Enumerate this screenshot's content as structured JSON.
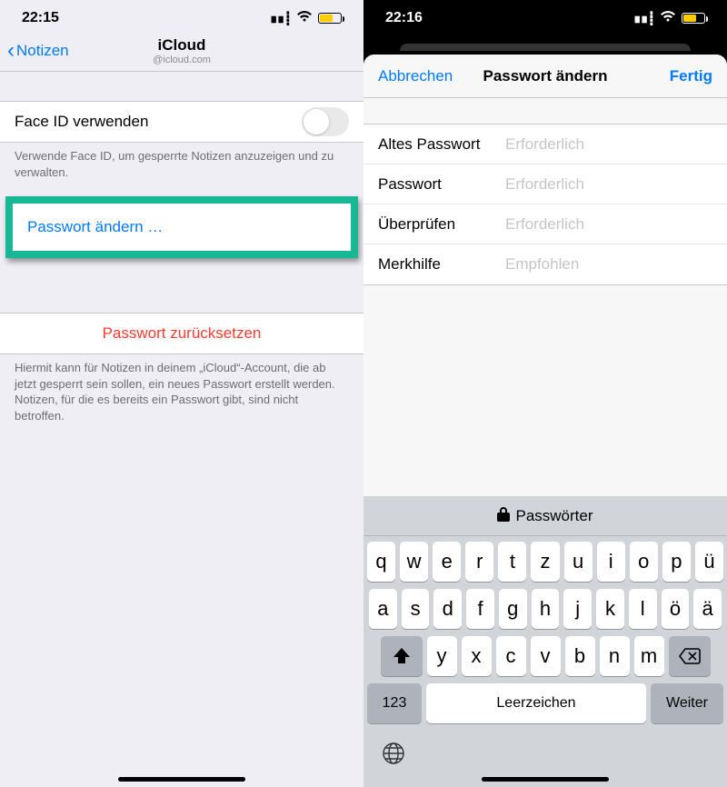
{
  "left": {
    "status_time": "22:15",
    "back_label": "Notizen",
    "title": "iCloud",
    "subtitle": "@icloud.com",
    "faceid_label": "Face ID verwenden",
    "faceid_footer": "Verwende Face ID, um gesperrte Notizen anzuzeigen und zu verwalten.",
    "change_pw_label": "Passwort ändern …",
    "reset_pw_label": "Passwort zurücksetzen",
    "reset_footer": "Hiermit kann für Notizen in deinem „iCloud“-Account, die ab jetzt gesperrt sein sollen, ein neues Passwort erstellt werden. Notizen, für die es bereits ein Passwort gibt, sind nicht betroffen."
  },
  "right": {
    "status_time": "22:16",
    "cancel": "Abbrechen",
    "title": "Passwort ändern",
    "done": "Fertig",
    "fields": [
      {
        "label": "Altes Passwort",
        "placeholder": "Erforderlich"
      },
      {
        "label": "Passwort",
        "placeholder": "Erforderlich"
      },
      {
        "label": "Überprüfen",
        "placeholder": "Erforderlich"
      },
      {
        "label": "Merkhilfe",
        "placeholder": "Empfohlen"
      }
    ],
    "keyboard": {
      "suggestion": "Passwörter",
      "row1": [
        "q",
        "w",
        "e",
        "r",
        "t",
        "z",
        "u",
        "i",
        "o",
        "p",
        "ü"
      ],
      "row2": [
        "a",
        "s",
        "d",
        "f",
        "g",
        "h",
        "j",
        "k",
        "l",
        "ö",
        "ä"
      ],
      "row3": [
        "y",
        "x",
        "c",
        "v",
        "b",
        "n",
        "m"
      ],
      "num_key": "123",
      "space_key": "Leerzeichen",
      "next_key": "Weiter"
    }
  }
}
